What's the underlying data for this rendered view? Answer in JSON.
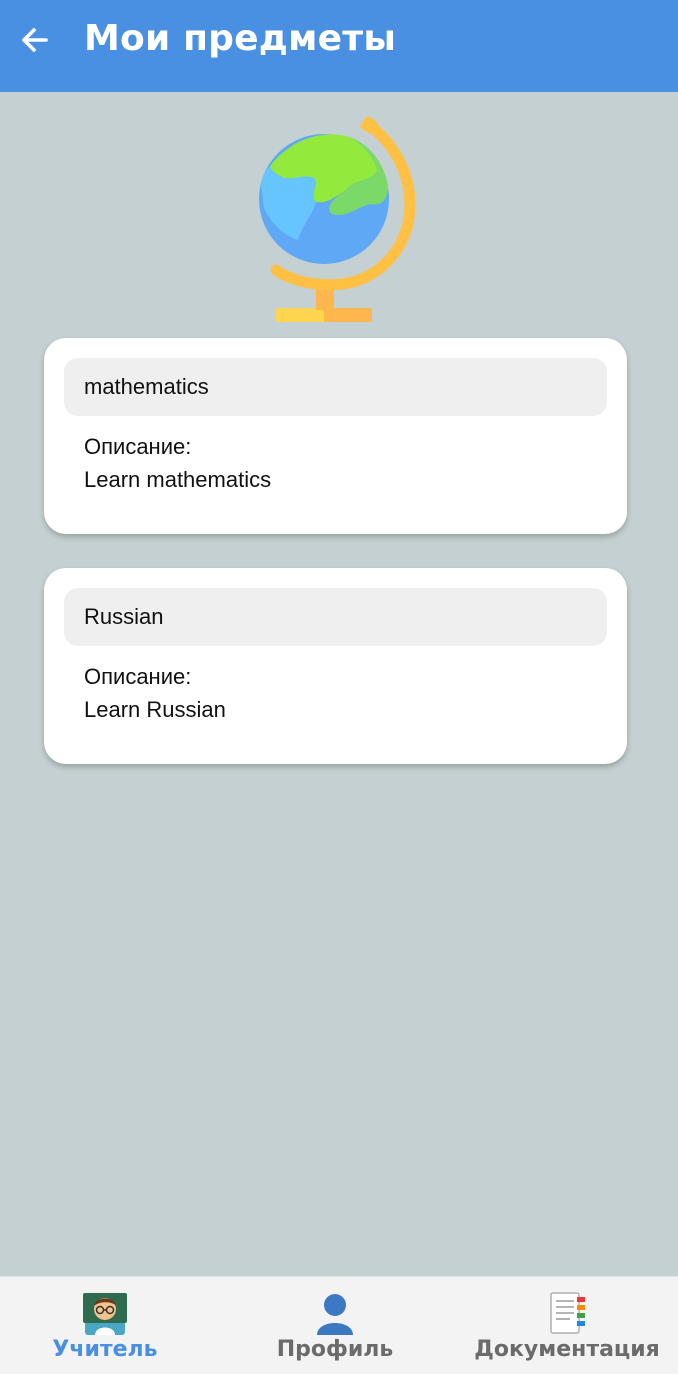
{
  "header": {
    "back_icon": "arrow-left-icon",
    "title": "Мои предметы"
  },
  "illustration": {
    "icon": "globe-icon"
  },
  "subjects": [
    {
      "title": "mathematics",
      "desc_label": "Описание:",
      "description": "Learn mathematics"
    },
    {
      "title": "Russian",
      "desc_label": "Описание:",
      "description": "Learn Russian"
    }
  ],
  "nav": {
    "items": [
      {
        "label": "Учитель",
        "icon": "teacher-icon",
        "active": true
      },
      {
        "label": "Профиль",
        "icon": "profile-icon",
        "active": false
      },
      {
        "label": "Документация",
        "icon": "documentation-icon",
        "active": false
      }
    ]
  },
  "colors": {
    "appbar": "#4a90e2",
    "background": "#c4d0d1",
    "active_nav": "#4a90e2",
    "inactive_nav": "#6b6b6b"
  }
}
